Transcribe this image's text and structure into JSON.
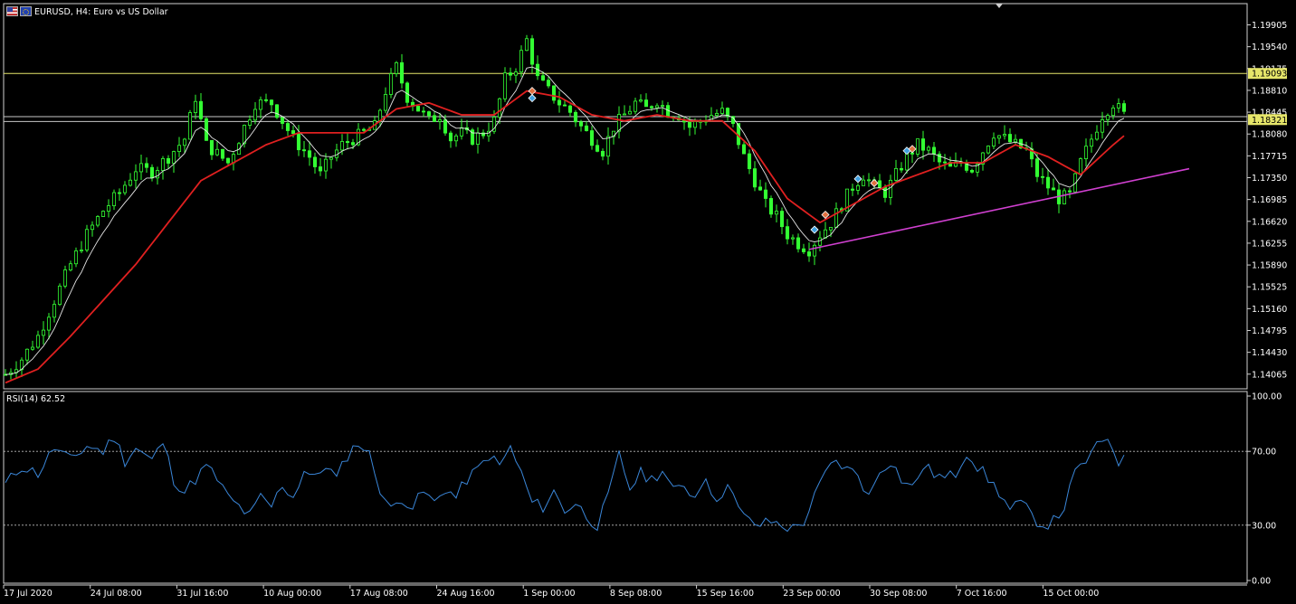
{
  "header": {
    "symbol_label": "EURUSD, H4:  Euro vs US Dollar",
    "flag_icons": [
      "us-flag-icon",
      "eu-flag-icon"
    ]
  },
  "colors": {
    "background": "#000000",
    "candle": "#33ff33",
    "ma_fast": "#e6e6e6",
    "ma_slow": "#e02020",
    "trendline": "#d040d0",
    "hline_upper": "#e6e66a",
    "hline_lower": "#c8c8c8",
    "rsi_line": "#3a86d8",
    "grid_dotted": "#bbbbbb"
  },
  "price_panel": {
    "y_ticks": [
      "1.19905",
      "1.19540",
      "1.19175",
      "1.18810",
      "1.18445",
      "1.18080",
      "1.17715",
      "1.17350",
      "1.16985",
      "1.16620",
      "1.16255",
      "1.15890",
      "1.15525",
      "1.15160",
      "1.14795",
      "1.14430",
      "1.14065"
    ],
    "level_tags": [
      {
        "label": "1.19093",
        "price": 1.19093,
        "bg": "#e6e66a"
      },
      {
        "label": "1.18321",
        "price": 1.18321,
        "bg": "#e6e66a"
      }
    ],
    "horizontal_lines": [
      {
        "price": 1.19093,
        "color": "#e6e66a"
      },
      {
        "price": 1.1837,
        "color": "#c8c8c8"
      },
      {
        "price": 1.1829,
        "color": "#c8c8c8"
      }
    ]
  },
  "rsi_panel": {
    "label": "RSI(14) 62.52",
    "y_ticks": [
      "100.00",
      "70.00",
      "30.00",
      "0.00"
    ],
    "levels": [
      70,
      30
    ]
  },
  "x_axis": {
    "labels": [
      "17 Jul 2020",
      "24 Jul 08:00",
      "31 Jul 16:00",
      "10 Aug 00:00",
      "17 Aug 08:00",
      "24 Aug 16:00",
      "1 Sep 00:00",
      "8 Sep 08:00",
      "15 Sep 16:00",
      "23 Sep 00:00",
      "30 Sep 08:00",
      "7 Oct 16:00",
      "15 Oct 00:00"
    ]
  },
  "chart_data": {
    "type": "candlestick",
    "symbol": "EURUSD",
    "timeframe": "H4",
    "ylim": [
      1.1385,
      1.202
    ],
    "rsi_ylim": [
      0,
      100
    ],
    "price_path": [
      [
        0,
        1.1406
      ],
      [
        3,
        1.1432
      ],
      [
        6,
        1.147
      ],
      [
        9,
        1.153
      ],
      [
        12,
        1.159
      ],
      [
        15,
        1.164
      ],
      [
        18,
        1.168
      ],
      [
        21,
        1.171
      ],
      [
        24,
        1.175
      ],
      [
        27,
        1.1745
      ],
      [
        30,
        1.177
      ],
      [
        33,
        1.18
      ],
      [
        35,
        1.187
      ],
      [
        37,
        1.179
      ],
      [
        39,
        1.1775
      ],
      [
        41,
        1.176
      ],
      [
        43,
        1.18
      ],
      [
        46,
        1.186
      ],
      [
        49,
        1.186
      ],
      [
        51,
        1.183
      ],
      [
        53,
        1.18
      ],
      [
        56,
        1.177
      ],
      [
        58,
        1.174
      ],
      [
        60,
        1.177
      ],
      [
        62,
        1.179
      ],
      [
        64,
        1.18
      ],
      [
        66,
        1.181
      ],
      [
        68,
        1.182
      ],
      [
        70,
        1.188
      ],
      [
        72,
        1.192
      ],
      [
        74,
        1.187
      ],
      [
        76,
        1.185
      ],
      [
        78,
        1.183
      ],
      [
        80,
        1.184
      ],
      [
        82,
        1.18
      ],
      [
        84,
        1.181
      ],
      [
        86,
        1.18
      ],
      [
        88,
        1.181
      ],
      [
        90,
        1.183
      ],
      [
        92,
        1.19
      ],
      [
        94,
        1.192
      ],
      [
        96,
        1.1965
      ],
      [
        98,
        1.19
      ],
      [
        100,
        1.188
      ],
      [
        102,
        1.186
      ],
      [
        104,
        1.1845
      ],
      [
        106,
        1.182
      ],
      [
        108,
        1.18
      ],
      [
        110,
        1.178
      ],
      [
        112,
        1.182
      ],
      [
        114,
        1.184
      ],
      [
        116,
        1.186
      ],
      [
        118,
        1.185
      ],
      [
        120,
        1.1865
      ],
      [
        122,
        1.1845
      ],
      [
        124,
        1.184
      ],
      [
        126,
        1.182
      ],
      [
        128,
        1.183
      ],
      [
        130,
        1.184
      ],
      [
        132,
        1.1845
      ],
      [
        134,
        1.182
      ],
      [
        136,
        1.177
      ],
      [
        138,
        1.173
      ],
      [
        140,
        1.169
      ],
      [
        142,
        1.167
      ],
      [
        144,
        1.164
      ],
      [
        146,
        1.1625
      ],
      [
        148,
        1.1615
      ],
      [
        150,
        1.164
      ],
      [
        152,
        1.166
      ],
      [
        154,
        1.169
      ],
      [
        156,
        1.172
      ],
      [
        158,
        1.174
      ],
      [
        160,
        1.172
      ],
      [
        162,
        1.171
      ],
      [
        164,
        1.174
      ],
      [
        166,
        1.177
      ],
      [
        168,
        1.179
      ],
      [
        170,
        1.178
      ],
      [
        172,
        1.176
      ],
      [
        174,
        1.175
      ],
      [
        176,
        1.176
      ],
      [
        178,
        1.175
      ],
      [
        180,
        1.178
      ],
      [
        182,
        1.181
      ],
      [
        184,
        1.18
      ],
      [
        186,
        1.179
      ],
      [
        188,
        1.178
      ],
      [
        190,
        1.174
      ],
      [
        192,
        1.172
      ],
      [
        194,
        1.17
      ],
      [
        196,
        1.1705
      ],
      [
        198,
        1.176
      ],
      [
        200,
        1.18
      ],
      [
        202,
        1.184
      ],
      [
        204,
        1.186
      ],
      [
        206,
        1.184
      ]
    ],
    "ma_slow_path": [
      [
        0,
        1.1392
      ],
      [
        6,
        1.1415
      ],
      [
        12,
        1.147
      ],
      [
        18,
        1.153
      ],
      [
        24,
        1.159
      ],
      [
        30,
        1.166
      ],
      [
        36,
        1.173
      ],
      [
        42,
        1.176
      ],
      [
        48,
        1.179
      ],
      [
        54,
        1.181
      ],
      [
        60,
        1.181
      ],
      [
        66,
        1.181
      ],
      [
        72,
        1.185
      ],
      [
        78,
        1.186
      ],
      [
        84,
        1.184
      ],
      [
        90,
        1.184
      ],
      [
        96,
        1.188
      ],
      [
        102,
        1.187
      ],
      [
        108,
        1.184
      ],
      [
        114,
        1.183
      ],
      [
        120,
        1.184
      ],
      [
        126,
        1.183
      ],
      [
        132,
        1.183
      ],
      [
        138,
        1.178
      ],
      [
        144,
        1.17
      ],
      [
        150,
        1.166
      ],
      [
        156,
        1.169
      ],
      [
        162,
        1.172
      ],
      [
        168,
        1.174
      ],
      [
        174,
        1.176
      ],
      [
        180,
        1.176
      ],
      [
        186,
        1.179
      ],
      [
        192,
        1.177
      ],
      [
        198,
        1.174
      ],
      [
        204,
        1.179
      ],
      [
        206,
        1.1805
      ]
    ],
    "trendline": [
      [
        148,
        1.1615
      ],
      [
        218,
        1.175
      ]
    ],
    "signal_markers": [
      {
        "i": 97,
        "price": 1.188,
        "kind": "sell"
      },
      {
        "i": 97,
        "price": 1.1868,
        "kind": "buy"
      },
      {
        "i": 149,
        "price": 1.1648,
        "kind": "buy"
      },
      {
        "i": 151,
        "price": 1.1673,
        "kind": "sell"
      },
      {
        "i": 157,
        "price": 1.1733,
        "kind": "buy"
      },
      {
        "i": 160,
        "price": 1.1726,
        "kind": "sell"
      },
      {
        "i": 166,
        "price": 1.178,
        "kind": "buy"
      },
      {
        "i": 167,
        "price": 1.1783,
        "kind": "sell"
      }
    ],
    "rsi_path": [
      [
        0,
        52
      ],
      [
        3,
        62
      ],
      [
        6,
        58
      ],
      [
        9,
        72
      ],
      [
        12,
        65
      ],
      [
        15,
        73
      ],
      [
        18,
        70
      ],
      [
        20,
        78
      ],
      [
        22,
        65
      ],
      [
        24,
        72
      ],
      [
        27,
        65
      ],
      [
        29,
        75
      ],
      [
        31,
        55
      ],
      [
        33,
        48
      ],
      [
        35,
        55
      ],
      [
        37,
        62
      ],
      [
        39,
        55
      ],
      [
        41,
        45
      ],
      [
        43,
        40
      ],
      [
        45,
        35
      ],
      [
        47,
        45
      ],
      [
        49,
        40
      ],
      [
        51,
        52
      ],
      [
        53,
        45
      ],
      [
        55,
        60
      ],
      [
        57,
        55
      ],
      [
        59,
        63
      ],
      [
        61,
        55
      ],
      [
        63,
        68
      ],
      [
        65,
        75
      ],
      [
        67,
        68
      ],
      [
        69,
        50
      ],
      [
        71,
        38
      ],
      [
        73,
        45
      ],
      [
        75,
        40
      ],
      [
        77,
        48
      ],
      [
        79,
        42
      ],
      [
        81,
        50
      ],
      [
        83,
        45
      ],
      [
        85,
        55
      ],
      [
        87,
        60
      ],
      [
        89,
        68
      ],
      [
        91,
        62
      ],
      [
        93,
        72
      ],
      [
        95,
        58
      ],
      [
        97,
        42
      ],
      [
        99,
        40
      ],
      [
        101,
        48
      ],
      [
        103,
        38
      ],
      [
        105,
        42
      ],
      [
        107,
        35
      ],
      [
        109,
        30
      ],
      [
        111,
        45
      ],
      [
        113,
        68
      ],
      [
        115,
        50
      ],
      [
        117,
        58
      ],
      [
        119,
        55
      ],
      [
        121,
        60
      ],
      [
        123,
        48
      ],
      [
        125,
        52
      ],
      [
        127,
        45
      ],
      [
        129,
        58
      ],
      [
        131,
        40
      ],
      [
        133,
        55
      ],
      [
        135,
        38
      ],
      [
        137,
        32
      ],
      [
        139,
        30
      ],
      [
        141,
        32
      ],
      [
        143,
        30
      ],
      [
        145,
        28
      ],
      [
        147,
        32
      ],
      [
        149,
        45
      ],
      [
        151,
        58
      ],
      [
        153,
        65
      ],
      [
        155,
        60
      ],
      [
        157,
        58
      ],
      [
        159,
        45
      ],
      [
        161,
        60
      ],
      [
        163,
        65
      ],
      [
        165,
        55
      ],
      [
        167,
        50
      ],
      [
        169,
        62
      ],
      [
        171,
        58
      ],
      [
        173,
        55
      ],
      [
        175,
        58
      ],
      [
        177,
        70
      ],
      [
        179,
        62
      ],
      [
        181,
        55
      ],
      [
        183,
        48
      ],
      [
        185,
        38
      ],
      [
        187,
        42
      ],
      [
        189,
        35
      ],
      [
        191,
        30
      ],
      [
        193,
        32
      ],
      [
        195,
        40
      ],
      [
        197,
        58
      ],
      [
        199,
        65
      ],
      [
        201,
        72
      ],
      [
        203,
        78
      ],
      [
        205,
        65
      ]
    ]
  }
}
